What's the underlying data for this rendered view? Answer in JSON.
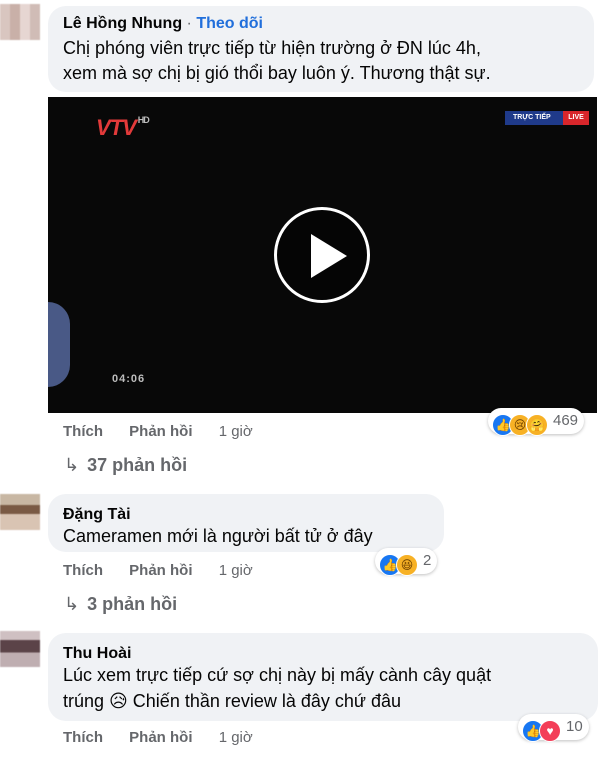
{
  "comments": [
    {
      "author": "Lê Hồng Nhung",
      "follow_label": "Theo dõi",
      "text_lines": [
        "Chị phóng viên trực tiếp từ hiện trường ở ĐN lúc 4h,",
        "xem mà sợ chị bị gió thổi bay luôn ý. Thương thật sự."
      ],
      "video": {
        "channel_logo": "VTV",
        "channel_suffix": "HD",
        "live_label": "TRỰC TIẾP",
        "live_badge": "LIVE",
        "timecode": "04:06",
        "play_icon": "play-icon"
      },
      "actions": {
        "like": "Thích",
        "reply": "Phản hồi",
        "time": "1 giờ"
      },
      "reactions": {
        "icons": [
          "like-icon",
          "sad-icon",
          "care-icon"
        ],
        "count": "469"
      },
      "replies_label": "37 phản hồi"
    },
    {
      "author": "Đặng Tài",
      "text_lines": [
        "Cameramen mới là người bất tử ở đây"
      ],
      "actions": {
        "like": "Thích",
        "reply": "Phản hồi",
        "time": "1 giờ"
      },
      "reactions": {
        "icons": [
          "like-icon",
          "haha-icon"
        ],
        "count": "2"
      },
      "replies_label": "3 phản hồi"
    },
    {
      "author": "Thu Hoài",
      "text_lines": [
        "Lúc xem trực tiếp cứ sợ chị này bị mấy cành cây quật",
        "trúng 😥 Chiến thần review là đây chứ đâu"
      ],
      "actions": {
        "like": "Thích",
        "reply": "Phản hồi",
        "time": "1 giờ"
      },
      "reactions": {
        "icons": [
          "like-icon",
          "love-icon"
        ],
        "count": "10"
      }
    }
  ],
  "colors": {
    "bubble": "#f0f2f5",
    "follow": "#216fdb",
    "meta": "#65676b",
    "like": "#1877f2",
    "love": "#f33e58"
  }
}
